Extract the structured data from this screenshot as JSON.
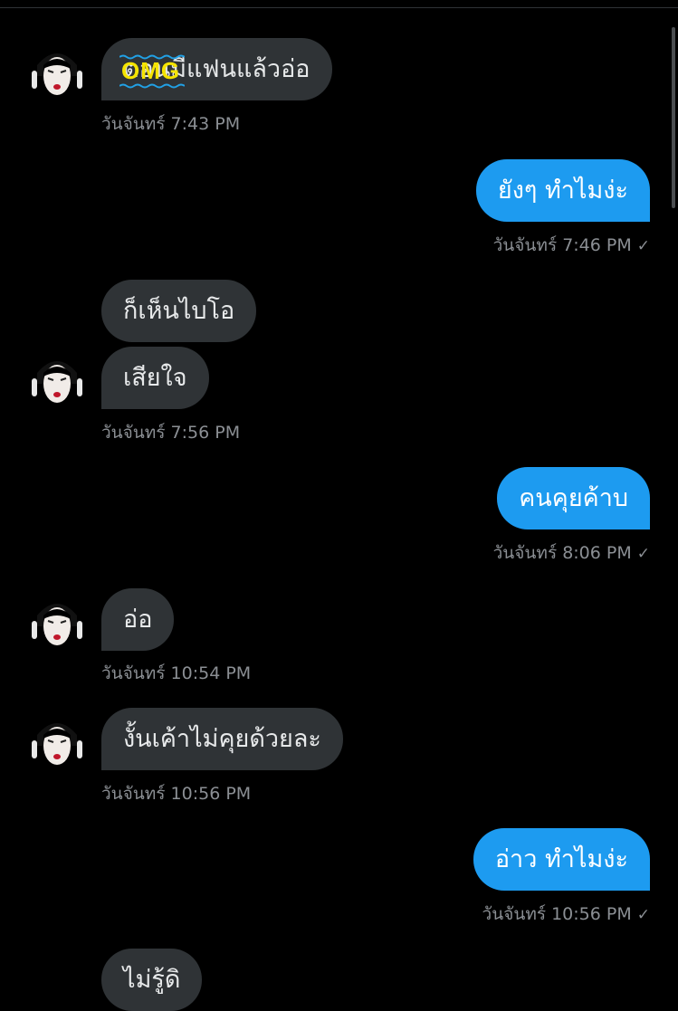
{
  "conversation": {
    "messages": [
      {
        "id": "m1",
        "direction": "in",
        "text": "ตอนมีแฟนแล้วอ่อ",
        "sticker_text": "OMG",
        "meta": "วันจันทร์ 7:43 PM"
      },
      {
        "id": "m2",
        "direction": "out",
        "text": "ยังๆ ทำไมง่ะ",
        "meta": "วันจันทร์ 7:46 PM"
      },
      {
        "id": "m3",
        "direction": "in",
        "text": "ก็เห็นไบโอ"
      },
      {
        "id": "m4",
        "direction": "in",
        "text": "เสียใจ",
        "meta": "วันจันทร์ 7:56 PM"
      },
      {
        "id": "m5",
        "direction": "out",
        "text": "คนคุยค้าบ",
        "meta": "วันจันทร์ 8:06 PM"
      },
      {
        "id": "m6",
        "direction": "in",
        "text": "อ่อ",
        "meta": "วันจันทร์ 10:54 PM"
      },
      {
        "id": "m7",
        "direction": "in",
        "text": "งั้นเค้าไม่คุยด้วยละ",
        "meta": "วันจันทร์ 10:56 PM"
      },
      {
        "id": "m8",
        "direction": "out",
        "text": "อ่าว ทำไมง่ะ",
        "meta": "วันจันทร์ 10:56 PM"
      },
      {
        "id": "m9",
        "direction": "in",
        "text": "ไม่รู้ดิ"
      }
    ],
    "read_receipt_icon": "check-icon",
    "avatar_icon": "user-avatar"
  },
  "colors": {
    "background": "#000000",
    "incoming_bubble": "#2f3336",
    "outgoing_bubble": "#1d9bf0",
    "meta_text": "#8b8f94",
    "sticker": "#f5e400"
  }
}
